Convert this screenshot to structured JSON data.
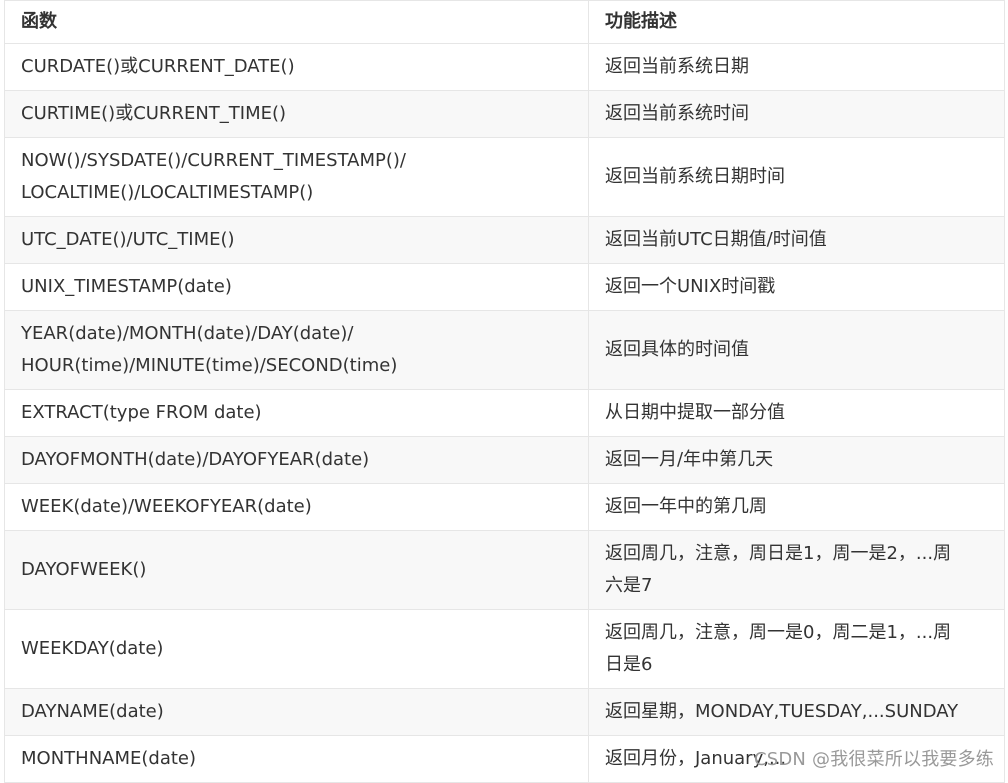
{
  "table": {
    "headers": [
      "函数",
      "功能描述"
    ],
    "rows": [
      {
        "fn": "CURDATE()或CURRENT_DATE()",
        "desc": "返回当前系统日期"
      },
      {
        "fn": "CURTIME()或CURRENT_TIME()",
        "desc": "返回当前系统时间"
      },
      {
        "fn": "NOW()/SYSDATE()/CURRENT_TIMESTAMP()/",
        "fn2": "LOCALTIME()/LOCALTIMESTAMP()",
        "desc": "返回当前系统日期时间"
      },
      {
        "fn": "UTC_DATE()/UTC_TIME()",
        "desc": "返回当前UTC日期值/时间值"
      },
      {
        "fn": "UNIX_TIMESTAMP(date)",
        "desc": "返回一个UNIX时间戳"
      },
      {
        "fn": "YEAR(date)/MONTH(date)/DAY(date)/",
        "fn2": "HOUR(time)/MINUTE(time)/SECOND(time)",
        "desc": "返回具体的时间值"
      },
      {
        "fn": "EXTRACT(type FROM date)",
        "desc": "从日期中提取一部分值"
      },
      {
        "fn": "DAYOFMONTH(date)/DAYOFYEAR(date)",
        "desc": "返回一月/年中第几天"
      },
      {
        "fn": "WEEK(date)/WEEKOFYEAR(date)",
        "desc": "返回一年中的第几周"
      },
      {
        "fn": "DAYOFWEEK()",
        "desc": "返回周几，注意，周日是1，周一是2，...周",
        "desc2": "六是7"
      },
      {
        "fn": "WEEKDAY(date)",
        "desc": "返回周几，注意，周一是0，周二是1，...周",
        "desc2": "日是6"
      },
      {
        "fn": "DAYNAME(date)",
        "desc": "返回星期，MONDAY,TUESDAY,...SUNDAY"
      },
      {
        "fn": "MONTHNAME(date)",
        "desc": "返回月份，January,..."
      }
    ]
  },
  "watermark": "CSDN @我很菜所以我要多练"
}
